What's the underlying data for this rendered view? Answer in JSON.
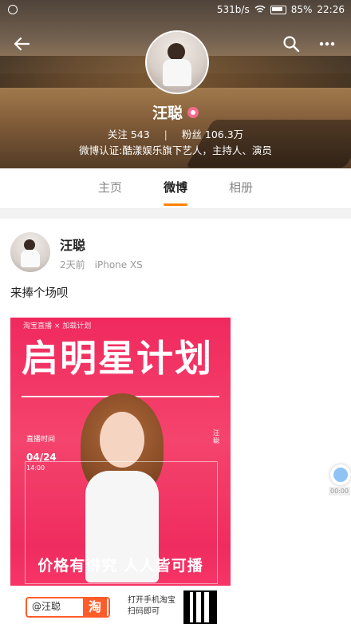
{
  "status_bar": {
    "speed": "531b/s",
    "battery_percent": "85%",
    "time": "22:26"
  },
  "header": {
    "name": "汪聪",
    "following_label": "关注",
    "following_count": "543",
    "separator": "|",
    "followers_label": "粉丝",
    "followers_count": "106.3万",
    "verification": "微博认证:酷漾娱乐旗下艺人，主持人、演员"
  },
  "tabs": [
    {
      "label": "主页",
      "active": false
    },
    {
      "label": "微博",
      "active": true
    },
    {
      "label": "相册",
      "active": false
    }
  ],
  "post": {
    "author": "汪聪",
    "time": "2天前",
    "source": "iPhone XS",
    "text": "来捧个场呗",
    "poster": {
      "brand": "淘宝直播 × 加载计划",
      "headline": "启明星计划",
      "live_label": "直播时间",
      "date": "04/24",
      "time": "14:00",
      "side_name": "汪聪",
      "slogan": "价格有讲究 人人皆可播"
    },
    "strip": {
      "handle": "@汪聪",
      "taobao_char": "淘",
      "scan_line1": "打开手机淘宝",
      "scan_line2": "扫码即可"
    }
  },
  "floating": {
    "time": "00:00"
  },
  "colors": {
    "accent": "#ff8200",
    "poster_red": "#f0295e"
  }
}
